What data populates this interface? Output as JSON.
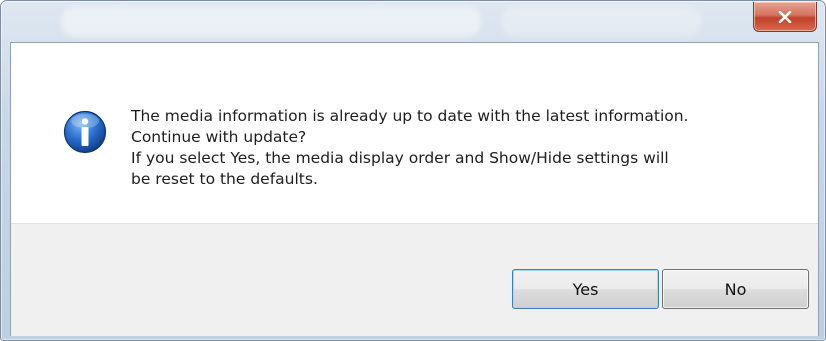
{
  "window": {
    "title": "",
    "close_icon": "close-icon",
    "close_color": "#c2412b"
  },
  "dialog": {
    "icon": "info-icon",
    "icon_color": "#1f5fbf",
    "message_lines": [
      "The media information is already up to date with the latest information.",
      "Continue with update?",
      "If you select Yes, the media display order and Show/Hide settings will",
      "be reset to the defaults."
    ]
  },
  "buttons": {
    "yes_label": "Yes",
    "no_label": "No"
  }
}
